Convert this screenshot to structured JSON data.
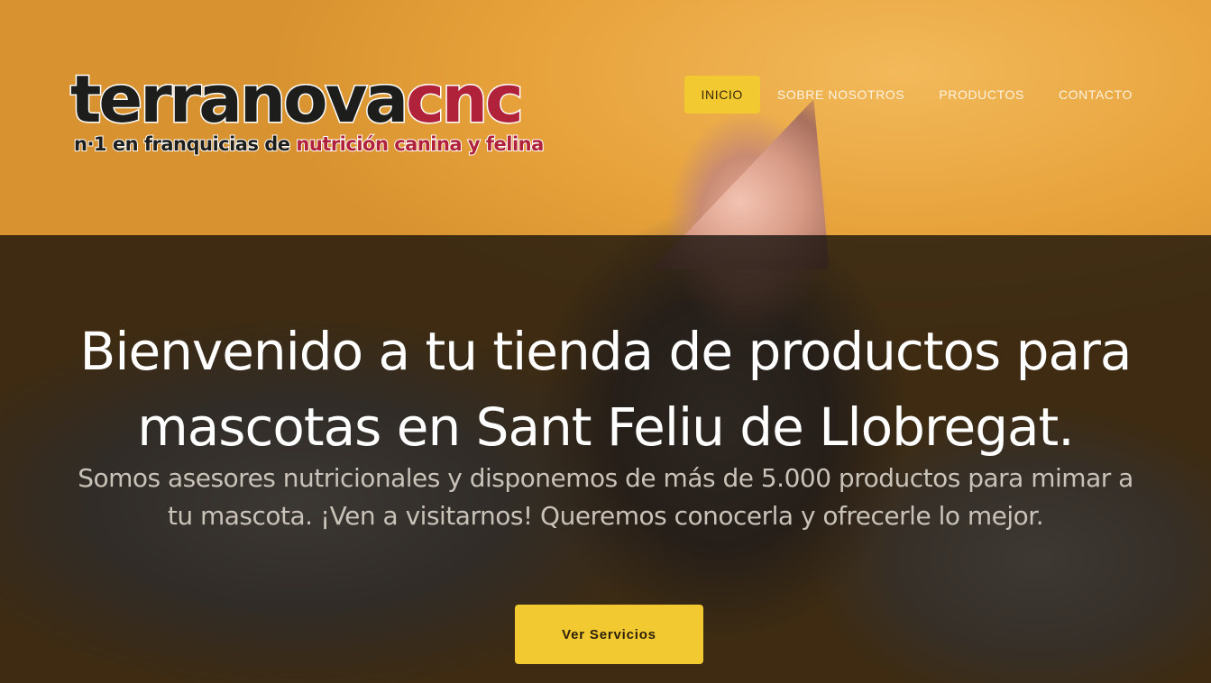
{
  "logo": {
    "brand_dark": "terranova",
    "brand_accent": "cnc",
    "tagline_dark": "n·1 en franquicias de ",
    "tagline_accent": "nutrición canina y felina"
  },
  "nav": {
    "items": [
      {
        "label": "INICIO",
        "active": true
      },
      {
        "label": "SOBRE NOSOTROS",
        "active": false
      },
      {
        "label": "PRODUCTOS",
        "active": false
      },
      {
        "label": "CONTACTO",
        "active": false
      }
    ]
  },
  "hero": {
    "title": "Bienvenido a tu tienda de productos para mascotas en Sant Feliu de Llobregat.",
    "subtitle": "Somos asesores nutricionales y disponemos de más de 5.000 productos para mimar a tu mascota. ¡Ven a visitarnos! Queremos conocerla y ofrecerle lo mejor.",
    "cta_label": "Ver Servicios"
  },
  "colors": {
    "accent": "#f2c930",
    "brand_red": "#b0213a",
    "brand_dark": "#1d1d1b"
  }
}
